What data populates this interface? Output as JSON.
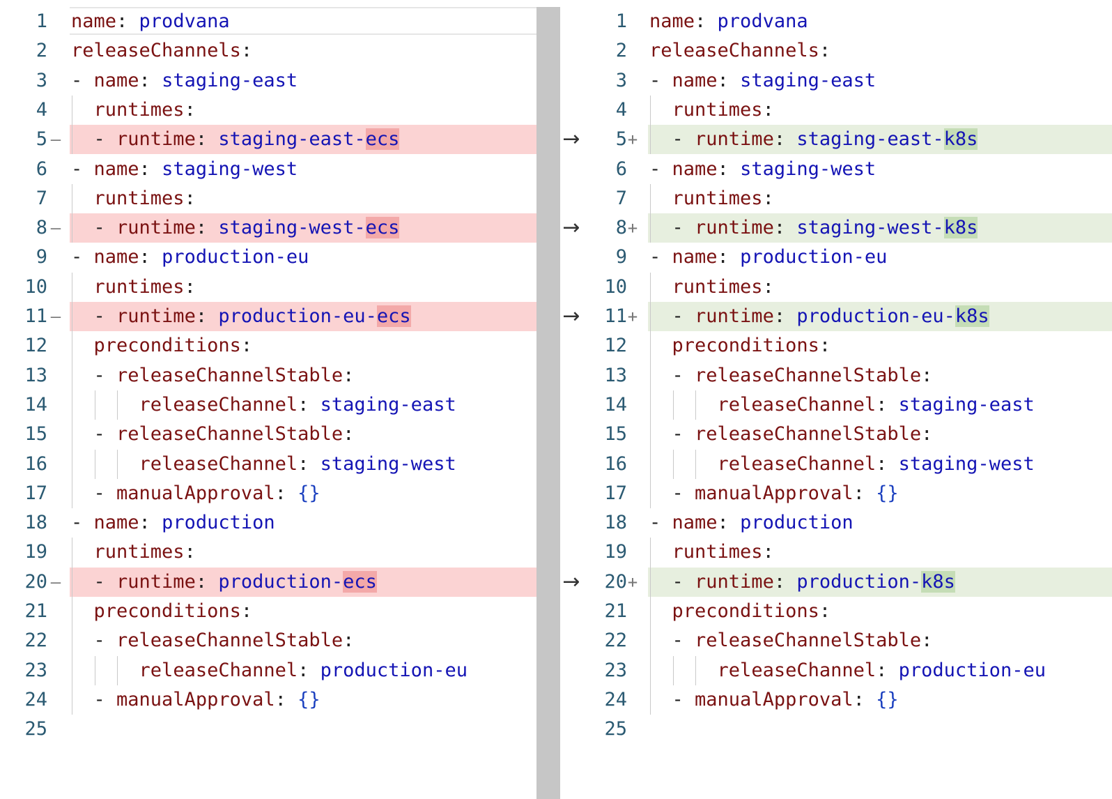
{
  "diff": {
    "left": {
      "lines": [
        {
          "n": "1",
          "t": "normal",
          "tokens": [
            {
              "c": "k",
              "s": "name"
            },
            {
              "c": "p",
              "s": ": "
            },
            {
              "c": "v",
              "s": "prodvana"
            }
          ]
        },
        {
          "n": "2",
          "t": "normal",
          "tokens": [
            {
              "c": "k",
              "s": "releaseChannels"
            },
            {
              "c": "p",
              "s": ":"
            }
          ]
        },
        {
          "n": "3",
          "t": "normal",
          "tokens": [
            {
              "c": "p",
              "s": "- "
            },
            {
              "c": "k",
              "s": "name"
            },
            {
              "c": "p",
              "s": ": "
            },
            {
              "c": "v",
              "s": "staging-east"
            }
          ]
        },
        {
          "n": "4",
          "t": "normal",
          "tokens": [
            {
              "c": "p",
              "s": "  "
            },
            {
              "c": "k",
              "s": "runtimes"
            },
            {
              "c": "p",
              "s": ":"
            }
          ]
        },
        {
          "n": "5",
          "t": "del",
          "mark": "—",
          "tokens": [
            {
              "c": "p",
              "s": "  - "
            },
            {
              "c": "k",
              "s": "runtime"
            },
            {
              "c": "p",
              "s": ": "
            },
            {
              "c": "v",
              "s": "staging-east-"
            },
            {
              "c": "v hl-del",
              "s": "ecs"
            }
          ]
        },
        {
          "n": "6",
          "t": "normal",
          "tokens": [
            {
              "c": "p",
              "s": "- "
            },
            {
              "c": "k",
              "s": "name"
            },
            {
              "c": "p",
              "s": ": "
            },
            {
              "c": "v",
              "s": "staging-west"
            }
          ]
        },
        {
          "n": "7",
          "t": "normal",
          "tokens": [
            {
              "c": "p",
              "s": "  "
            },
            {
              "c": "k",
              "s": "runtimes"
            },
            {
              "c": "p",
              "s": ":"
            }
          ]
        },
        {
          "n": "8",
          "t": "del",
          "mark": "—",
          "tokens": [
            {
              "c": "p",
              "s": "  - "
            },
            {
              "c": "k",
              "s": "runtime"
            },
            {
              "c": "p",
              "s": ": "
            },
            {
              "c": "v",
              "s": "staging-west-"
            },
            {
              "c": "v hl-del",
              "s": "ecs"
            }
          ]
        },
        {
          "n": "9",
          "t": "normal",
          "tokens": [
            {
              "c": "p",
              "s": "- "
            },
            {
              "c": "k",
              "s": "name"
            },
            {
              "c": "p",
              "s": ": "
            },
            {
              "c": "v",
              "s": "production-eu"
            }
          ]
        },
        {
          "n": "10",
          "t": "normal",
          "tokens": [
            {
              "c": "p",
              "s": "  "
            },
            {
              "c": "k",
              "s": "runtimes"
            },
            {
              "c": "p",
              "s": ":"
            }
          ]
        },
        {
          "n": "11",
          "t": "del",
          "mark": "—",
          "tokens": [
            {
              "c": "p",
              "s": "  - "
            },
            {
              "c": "k",
              "s": "runtime"
            },
            {
              "c": "p",
              "s": ": "
            },
            {
              "c": "v",
              "s": "production-eu-"
            },
            {
              "c": "v hl-del",
              "s": "ecs"
            }
          ]
        },
        {
          "n": "12",
          "t": "normal",
          "tokens": [
            {
              "c": "p",
              "s": "  "
            },
            {
              "c": "k",
              "s": "preconditions"
            },
            {
              "c": "p",
              "s": ":"
            }
          ]
        },
        {
          "n": "13",
          "t": "normal",
          "tokens": [
            {
              "c": "p",
              "s": "  - "
            },
            {
              "c": "k",
              "s": "releaseChannelStable"
            },
            {
              "c": "p",
              "s": ":"
            }
          ]
        },
        {
          "n": "14",
          "t": "normal",
          "tokens": [
            {
              "c": "p",
              "s": "      "
            },
            {
              "c": "k",
              "s": "releaseChannel"
            },
            {
              "c": "p",
              "s": ": "
            },
            {
              "c": "v",
              "s": "staging-east"
            }
          ]
        },
        {
          "n": "15",
          "t": "normal",
          "tokens": [
            {
              "c": "p",
              "s": "  - "
            },
            {
              "c": "k",
              "s": "releaseChannelStable"
            },
            {
              "c": "p",
              "s": ":"
            }
          ]
        },
        {
          "n": "16",
          "t": "normal",
          "tokens": [
            {
              "c": "p",
              "s": "      "
            },
            {
              "c": "k",
              "s": "releaseChannel"
            },
            {
              "c": "p",
              "s": ": "
            },
            {
              "c": "v",
              "s": "staging-west"
            }
          ]
        },
        {
          "n": "17",
          "t": "normal",
          "tokens": [
            {
              "c": "p",
              "s": "  - "
            },
            {
              "c": "k",
              "s": "manualApproval"
            },
            {
              "c": "p",
              "s": ": "
            },
            {
              "c": "b",
              "s": "{}"
            }
          ]
        },
        {
          "n": "18",
          "t": "normal",
          "tokens": [
            {
              "c": "p",
              "s": "- "
            },
            {
              "c": "k",
              "s": "name"
            },
            {
              "c": "p",
              "s": ": "
            },
            {
              "c": "v",
              "s": "production"
            }
          ]
        },
        {
          "n": "19",
          "t": "normal",
          "tokens": [
            {
              "c": "p",
              "s": "  "
            },
            {
              "c": "k",
              "s": "runtimes"
            },
            {
              "c": "p",
              "s": ":"
            }
          ]
        },
        {
          "n": "20",
          "t": "del",
          "mark": "—",
          "tokens": [
            {
              "c": "p",
              "s": "  - "
            },
            {
              "c": "k",
              "s": "runtime"
            },
            {
              "c": "p",
              "s": ": "
            },
            {
              "c": "v",
              "s": "production-"
            },
            {
              "c": "v hl-del",
              "s": "ecs"
            }
          ]
        },
        {
          "n": "21",
          "t": "normal",
          "tokens": [
            {
              "c": "p",
              "s": "  "
            },
            {
              "c": "k",
              "s": "preconditions"
            },
            {
              "c": "p",
              "s": ":"
            }
          ]
        },
        {
          "n": "22",
          "t": "normal",
          "tokens": [
            {
              "c": "p",
              "s": "  - "
            },
            {
              "c": "k",
              "s": "releaseChannelStable"
            },
            {
              "c": "p",
              "s": ":"
            }
          ]
        },
        {
          "n": "23",
          "t": "normal",
          "tokens": [
            {
              "c": "p",
              "s": "      "
            },
            {
              "c": "k",
              "s": "releaseChannel"
            },
            {
              "c": "p",
              "s": ": "
            },
            {
              "c": "v",
              "s": "production-eu"
            }
          ]
        },
        {
          "n": "24",
          "t": "normal",
          "tokens": [
            {
              "c": "p",
              "s": "  - "
            },
            {
              "c": "k",
              "s": "manualApproval"
            },
            {
              "c": "p",
              "s": ": "
            },
            {
              "c": "b",
              "s": "{}"
            }
          ]
        },
        {
          "n": "25",
          "t": "normal",
          "tokens": []
        }
      ]
    },
    "right": {
      "lines": [
        {
          "n": "1",
          "t": "normal",
          "tokens": [
            {
              "c": "k",
              "s": "name"
            },
            {
              "c": "p",
              "s": ": "
            },
            {
              "c": "v",
              "s": "prodvana"
            }
          ]
        },
        {
          "n": "2",
          "t": "normal",
          "tokens": [
            {
              "c": "k",
              "s": "releaseChannels"
            },
            {
              "c": "p",
              "s": ":"
            }
          ]
        },
        {
          "n": "3",
          "t": "normal",
          "tokens": [
            {
              "c": "p",
              "s": "- "
            },
            {
              "c": "k",
              "s": "name"
            },
            {
              "c": "p",
              "s": ": "
            },
            {
              "c": "v",
              "s": "staging-east"
            }
          ]
        },
        {
          "n": "4",
          "t": "normal",
          "tokens": [
            {
              "c": "p",
              "s": "  "
            },
            {
              "c": "k",
              "s": "runtimes"
            },
            {
              "c": "p",
              "s": ":"
            }
          ]
        },
        {
          "n": "5",
          "t": "ins",
          "mark": "+",
          "tokens": [
            {
              "c": "p",
              "s": "  - "
            },
            {
              "c": "k",
              "s": "runtime"
            },
            {
              "c": "p",
              "s": ": "
            },
            {
              "c": "v",
              "s": "staging-east-"
            },
            {
              "c": "v hl-ins",
              "s": "k8s"
            }
          ]
        },
        {
          "n": "6",
          "t": "normal",
          "tokens": [
            {
              "c": "p",
              "s": "- "
            },
            {
              "c": "k",
              "s": "name"
            },
            {
              "c": "p",
              "s": ": "
            },
            {
              "c": "v",
              "s": "staging-west"
            }
          ]
        },
        {
          "n": "7",
          "t": "normal",
          "tokens": [
            {
              "c": "p",
              "s": "  "
            },
            {
              "c": "k",
              "s": "runtimes"
            },
            {
              "c": "p",
              "s": ":"
            }
          ]
        },
        {
          "n": "8",
          "t": "ins",
          "mark": "+",
          "tokens": [
            {
              "c": "p",
              "s": "  - "
            },
            {
              "c": "k",
              "s": "runtime"
            },
            {
              "c": "p",
              "s": ": "
            },
            {
              "c": "v",
              "s": "staging-west-"
            },
            {
              "c": "v hl-ins",
              "s": "k8s"
            }
          ]
        },
        {
          "n": "9",
          "t": "normal",
          "tokens": [
            {
              "c": "p",
              "s": "- "
            },
            {
              "c": "k",
              "s": "name"
            },
            {
              "c": "p",
              "s": ": "
            },
            {
              "c": "v",
              "s": "production-eu"
            }
          ]
        },
        {
          "n": "10",
          "t": "normal",
          "tokens": [
            {
              "c": "p",
              "s": "  "
            },
            {
              "c": "k",
              "s": "runtimes"
            },
            {
              "c": "p",
              "s": ":"
            }
          ]
        },
        {
          "n": "11",
          "t": "ins",
          "mark": "+",
          "tokens": [
            {
              "c": "p",
              "s": "  - "
            },
            {
              "c": "k",
              "s": "runtime"
            },
            {
              "c": "p",
              "s": ": "
            },
            {
              "c": "v",
              "s": "production-eu-"
            },
            {
              "c": "v hl-ins",
              "s": "k8s"
            }
          ]
        },
        {
          "n": "12",
          "t": "normal",
          "tokens": [
            {
              "c": "p",
              "s": "  "
            },
            {
              "c": "k",
              "s": "preconditions"
            },
            {
              "c": "p",
              "s": ":"
            }
          ]
        },
        {
          "n": "13",
          "t": "normal",
          "tokens": [
            {
              "c": "p",
              "s": "  - "
            },
            {
              "c": "k",
              "s": "releaseChannelStable"
            },
            {
              "c": "p",
              "s": ":"
            }
          ]
        },
        {
          "n": "14",
          "t": "normal",
          "tokens": [
            {
              "c": "p",
              "s": "      "
            },
            {
              "c": "k",
              "s": "releaseChannel"
            },
            {
              "c": "p",
              "s": ": "
            },
            {
              "c": "v",
              "s": "staging-east"
            }
          ]
        },
        {
          "n": "15",
          "t": "normal",
          "tokens": [
            {
              "c": "p",
              "s": "  - "
            },
            {
              "c": "k",
              "s": "releaseChannelStable"
            },
            {
              "c": "p",
              "s": ":"
            }
          ]
        },
        {
          "n": "16",
          "t": "normal",
          "tokens": [
            {
              "c": "p",
              "s": "      "
            },
            {
              "c": "k",
              "s": "releaseChannel"
            },
            {
              "c": "p",
              "s": ": "
            },
            {
              "c": "v",
              "s": "staging-west"
            }
          ]
        },
        {
          "n": "17",
          "t": "normal",
          "tokens": [
            {
              "c": "p",
              "s": "  - "
            },
            {
              "c": "k",
              "s": "manualApproval"
            },
            {
              "c": "p",
              "s": ": "
            },
            {
              "c": "b",
              "s": "{}"
            }
          ]
        },
        {
          "n": "18",
          "t": "normal",
          "tokens": [
            {
              "c": "p",
              "s": "- "
            },
            {
              "c": "k",
              "s": "name"
            },
            {
              "c": "p",
              "s": ": "
            },
            {
              "c": "v",
              "s": "production"
            }
          ]
        },
        {
          "n": "19",
          "t": "normal",
          "tokens": [
            {
              "c": "p",
              "s": "  "
            },
            {
              "c": "k",
              "s": "runtimes"
            },
            {
              "c": "p",
              "s": ":"
            }
          ]
        },
        {
          "n": "20",
          "t": "ins",
          "mark": "+",
          "tokens": [
            {
              "c": "p",
              "s": "  - "
            },
            {
              "c": "k",
              "s": "runtime"
            },
            {
              "c": "p",
              "s": ": "
            },
            {
              "c": "v",
              "s": "production-"
            },
            {
              "c": "v hl-ins",
              "s": "k8s"
            }
          ]
        },
        {
          "n": "21",
          "t": "normal",
          "tokens": [
            {
              "c": "p",
              "s": "  "
            },
            {
              "c": "k",
              "s": "preconditions"
            },
            {
              "c": "p",
              "s": ":"
            }
          ]
        },
        {
          "n": "22",
          "t": "normal",
          "tokens": [
            {
              "c": "p",
              "s": "  - "
            },
            {
              "c": "k",
              "s": "releaseChannelStable"
            },
            {
              "c": "p",
              "s": ":"
            }
          ]
        },
        {
          "n": "23",
          "t": "normal",
          "tokens": [
            {
              "c": "p",
              "s": "      "
            },
            {
              "c": "k",
              "s": "releaseChannel"
            },
            {
              "c": "p",
              "s": ": "
            },
            {
              "c": "v",
              "s": "production-eu"
            }
          ]
        },
        {
          "n": "24",
          "t": "normal",
          "tokens": [
            {
              "c": "p",
              "s": "  - "
            },
            {
              "c": "k",
              "s": "manualApproval"
            },
            {
              "c": "p",
              "s": ": "
            },
            {
              "c": "b",
              "s": "{}"
            }
          ]
        },
        {
          "n": "25",
          "t": "normal",
          "tokens": []
        }
      ]
    },
    "change_arrow": "→",
    "colors": {
      "deleted_line_bg": "#fbd3d3",
      "inserted_line_bg": "#e7efdf",
      "key": "#7a1212",
      "value": "#1414b4",
      "line_number": "#2b5a72",
      "scrollbar": "#c6c6c6"
    },
    "icons": {
      "deleted_marker": "minus-icon",
      "inserted_marker": "plus-icon",
      "change_arrow": "right-arrow-icon"
    }
  }
}
